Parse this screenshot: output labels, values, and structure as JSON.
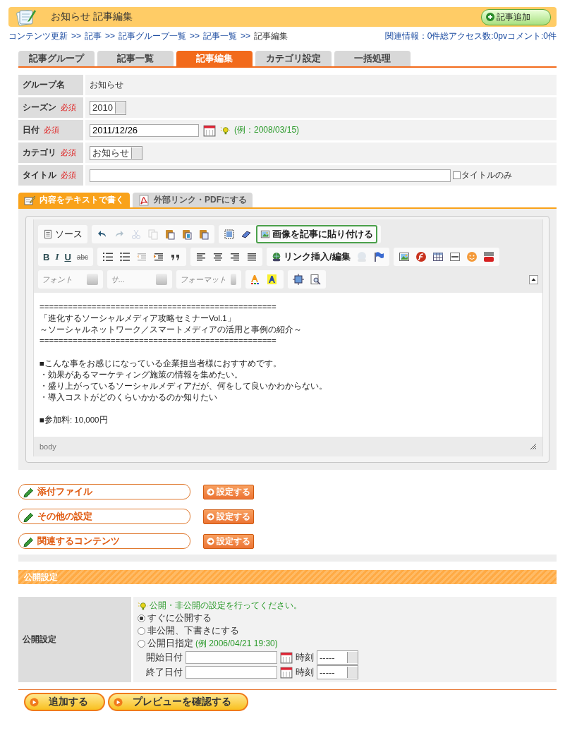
{
  "header": {
    "title": "お知らせ 記事編集",
    "add_button": "記事追加"
  },
  "breadcrumb": {
    "separator": ">>",
    "items": [
      {
        "label": "コンテンツ更新",
        "kind": "link"
      },
      {
        "label": "記事",
        "kind": "link"
      },
      {
        "label": "記事グループ一覧",
        "kind": "link"
      },
      {
        "label": "記事一覧",
        "kind": "link"
      },
      {
        "label": "記事編集",
        "kind": "current"
      }
    ]
  },
  "related_info": "関連情報：0件総アクセス数:0pvコメント:0件",
  "tabs": [
    {
      "label": "記事グループ",
      "selected": false
    },
    {
      "label": "記事一覧",
      "selected": false
    },
    {
      "label": "記事編集",
      "selected": true
    },
    {
      "label": "カテゴリ設定",
      "selected": false
    },
    {
      "label": "一括処理",
      "selected": false
    }
  ],
  "form": [
    {
      "kind": "text",
      "label": "グループ名",
      "value": "お知らせ"
    },
    {
      "kind": "select",
      "label": "シーズン",
      "required": "必須",
      "value": "2010"
    },
    {
      "kind": "date",
      "label": "日付",
      "required": "必須",
      "value": "2011/12/26",
      "hint": "(例：2008/03/15)"
    },
    {
      "kind": "select",
      "label": "カテゴリ",
      "required": "必須",
      "value": "お知らせ"
    },
    {
      "kind": "input",
      "label": "タイトル",
      "required": "必須",
      "checkbox": {
        "label": "タイトルのみ",
        "checked": false
      }
    }
  ],
  "content_tabs": [
    {
      "label": "内容をテキストで書く",
      "kind": "text",
      "selected": true
    },
    {
      "label": "外部リンク・PDFにする",
      "kind": "pdf",
      "selected": false
    }
  ],
  "editor": {
    "toolbar": [
      [
        [
          {
            "kind": "source",
            "label": "ソース",
            "disabled": false
          }
        ],
        [
          {
            "kind": "undo",
            "disabled": false
          },
          {
            "kind": "redo",
            "disabled": true
          },
          {
            "kind": "cut",
            "disabled": true
          },
          {
            "kind": "copy",
            "disabled": true
          },
          {
            "kind": "paste",
            "disabled": false
          },
          {
            "kind": "paste_text",
            "disabled": false
          },
          {
            "kind": "paste_word",
            "disabled": false
          }
        ],
        [
          {
            "kind": "select_all",
            "disabled": false
          },
          {
            "kind": "eraser",
            "disabled": false
          },
          {
            "kind": "image_paste",
            "label": "画像を記事に貼り付ける",
            "disabled": false
          }
        ]
      ],
      [
        [
          {
            "kind": "bold",
            "text": "B",
            "disabled": false
          },
          {
            "kind": "italic",
            "text": "I",
            "disabled": false
          },
          {
            "kind": "underline",
            "text": "U",
            "disabled": false
          },
          {
            "kind": "strike",
            "text": "abc",
            "disabled": false
          }
        ],
        [
          {
            "kind": "numbered_list",
            "disabled": false
          },
          {
            "kind": "bullet_list",
            "disabled": false
          },
          {
            "kind": "outdent",
            "disabled": true
          },
          {
            "kind": "indent",
            "disabled": false
          },
          {
            "kind": "quote",
            "disabled": false
          }
        ],
        [
          {
            "kind": "align_left",
            "disabled": false
          },
          {
            "kind": "align_center",
            "disabled": false
          },
          {
            "kind": "align_right",
            "disabled": false
          },
          {
            "kind": "justify",
            "disabled": false
          }
        ],
        [
          {
            "kind": "link",
            "label": "リンク挿入/編集",
            "disabled": false
          },
          {
            "kind": "unlink",
            "disabled": true
          },
          {
            "kind": "anchor",
            "disabled": false
          }
        ],
        [
          {
            "kind": "image",
            "disabled": false
          },
          {
            "kind": "flash",
            "disabled": false
          },
          {
            "kind": "table",
            "disabled": false
          },
          {
            "kind": "rule",
            "disabled": false
          },
          {
            "kind": "smiley",
            "disabled": false
          },
          {
            "kind": "video",
            "disabled": false
          }
        ]
      ],
      [
        [
          {
            "kind": "combo",
            "label": "フォント",
            "disabled": false
          }
        ],
        [
          {
            "kind": "combo",
            "label": "サ...",
            "disabled": false
          }
        ],
        [
          {
            "kind": "combo",
            "label": "フォーマット",
            "disabled": false
          }
        ],
        [
          {
            "kind": "text_color",
            "disabled": false
          },
          {
            "kind": "bg_color",
            "disabled": false
          }
        ],
        [
          {
            "kind": "maximize",
            "disabled": false
          },
          {
            "kind": "preview",
            "disabled": false
          }
        ]
      ]
    ],
    "blocks": [
      [
        "==================================================",
        "「進化するソーシャルメディア攻略セミナーVol.1」",
        "～ソーシャルネットワーク／スマートメディアの活用と事例の紹介～",
        "=================================================="
      ],
      [
        "■こんな事をお感じになっている企業担当者様におすすめです。",
        "・効果があるマーケティング施策の情報を集めたい。",
        "・盛り上がっているソーシャルメディアだが、何をして良いかわからない。",
        "・導入コストがどのくらいかかるのか知りたい"
      ],
      [
        "■参加料: 10,000円"
      ]
    ],
    "status": "body"
  },
  "options": [
    {
      "label": "添付ファイル",
      "button": "設定する"
    },
    {
      "label": "その他の設定",
      "button": "設定する"
    },
    {
      "label": "関連するコンテンツ",
      "button": "設定する"
    }
  ],
  "publish": {
    "heading": "公開設定",
    "label": "公開設定",
    "hint": "公開・非公開の設定を行ってください。",
    "radios": [
      {
        "label": "すぐに公開する",
        "selected": true
      },
      {
        "label": "非公開、下書きにする",
        "selected": false
      },
      {
        "label": "公開日指定",
        "example": "(例 2006/04/21 19:30)",
        "selected": false
      }
    ],
    "dates": [
      {
        "label": "開始日付",
        "time_label": "時刻",
        "time_value": "-----"
      },
      {
        "label": "終了日付",
        "time_label": "時刻",
        "time_value": "-----"
      }
    ]
  },
  "buttons": [
    "追加する",
    "プレビューを確認する"
  ]
}
